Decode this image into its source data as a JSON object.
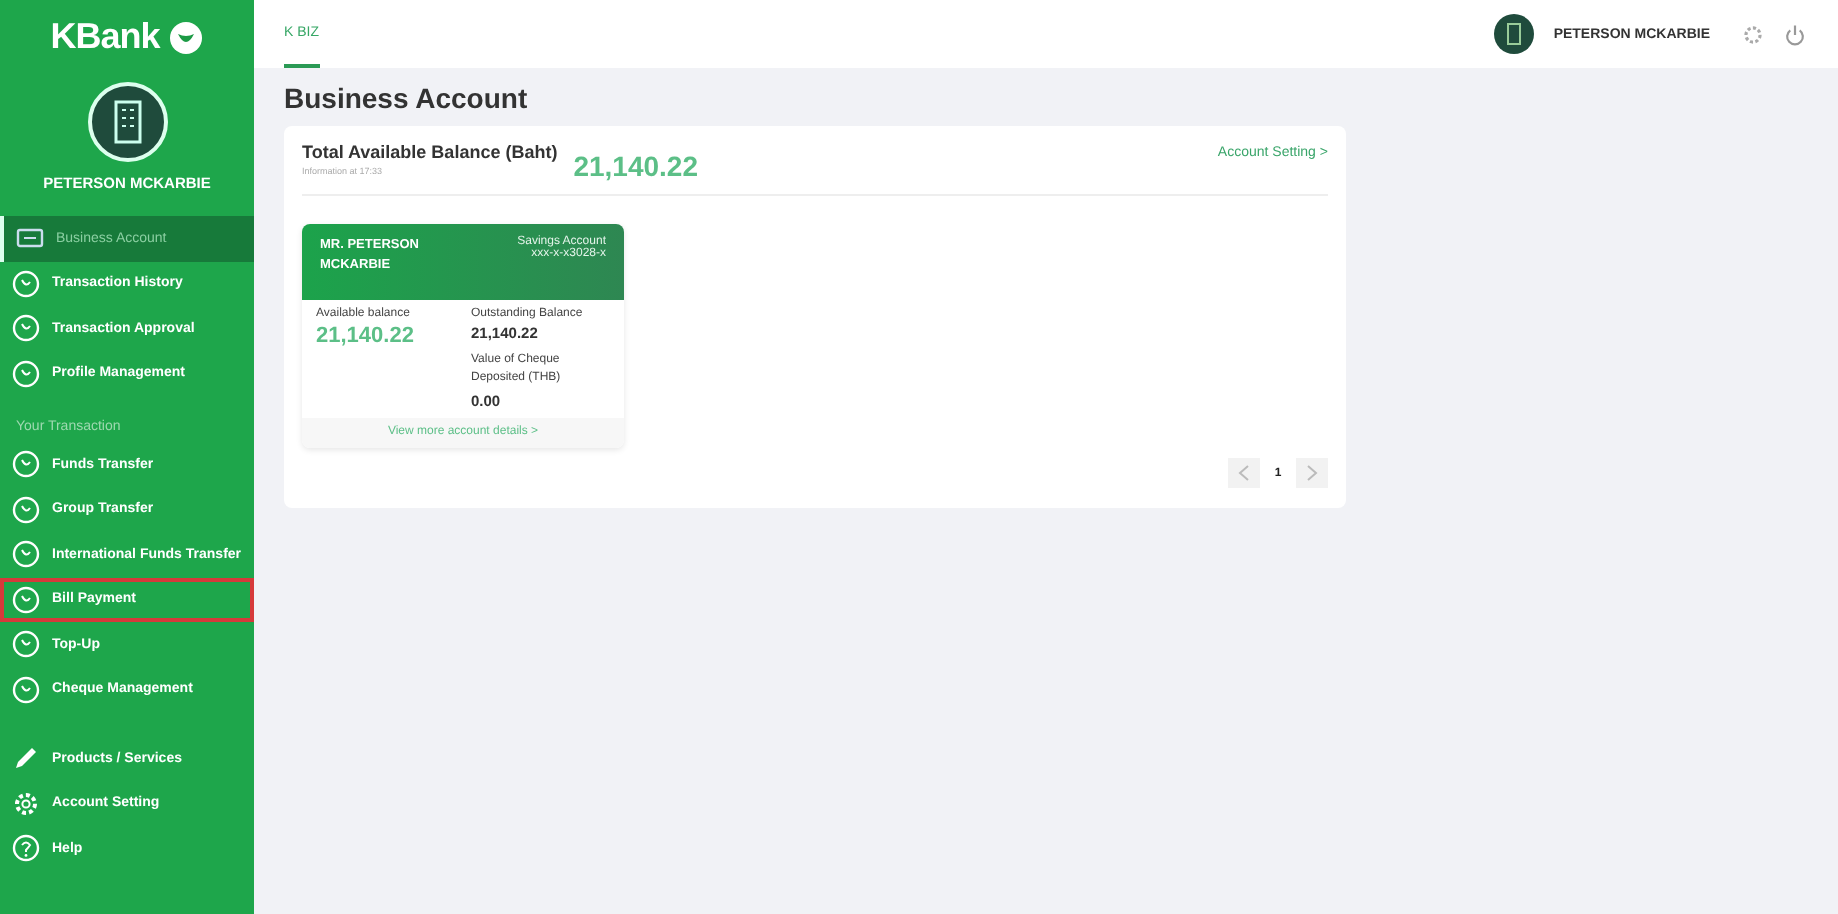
{
  "sidebar": {
    "logo": "KBank",
    "user_name": "PETERSON MCKARBIE",
    "groups": [
      {
        "items": [
          {
            "label": "Business Account",
            "kind": "card",
            "selected": true,
            "highlighted": false
          },
          {
            "label": "Transaction History",
            "kind": "circle",
            "selected": false,
            "highlighted": false
          },
          {
            "label": "Transaction Approval",
            "kind": "circle",
            "selected": false,
            "highlighted": false
          },
          {
            "label": "Profile Management",
            "kind": "circle",
            "selected": false,
            "highlighted": false
          }
        ]
      },
      {
        "heading": "Your Transaction",
        "items": [
          {
            "label": "Funds Transfer",
            "kind": "circle",
            "selected": false,
            "highlighted": false
          },
          {
            "label": "Group Transfer",
            "kind": "circle",
            "selected": false,
            "highlighted": false
          },
          {
            "label": "International Funds Transfer",
            "kind": "circle",
            "selected": false,
            "highlighted": false
          },
          {
            "label": "Bill Payment",
            "kind": "circle",
            "selected": false,
            "highlighted": true
          },
          {
            "label": "Top-Up",
            "kind": "circle",
            "selected": false,
            "highlighted": false
          },
          {
            "label": "Cheque Management",
            "kind": "circle",
            "selected": false,
            "highlighted": false
          }
        ]
      },
      {
        "items": [
          {
            "label": "Products / Services",
            "kind": "pencil",
            "selected": false,
            "highlighted": false
          },
          {
            "label": "Account Setting",
            "kind": "gear",
            "selected": false,
            "highlighted": false
          },
          {
            "label": "Help",
            "kind": "help",
            "selected": false,
            "highlighted": false
          }
        ]
      }
    ]
  },
  "topbar": {
    "tab": "K BIZ",
    "user_name": "PETERSON MCKARBIE"
  },
  "page_title": "Business Account",
  "balance": {
    "label": "Total Available Balance (Baht)",
    "updated": "Information at 17:33",
    "amount": "21,140.22",
    "link": "Account Setting >"
  },
  "account_card": {
    "holder": "MR. PETERSON MCKARBIE",
    "type": "Savings Account",
    "number": "xxx-x-x3028-x",
    "available_label": "Available balance",
    "available": "21,140.22",
    "outstanding_label": "Outstanding Balance",
    "outstanding": "21,140.22",
    "cheque_label": "Value of Cheque Deposited (THB)",
    "cheque": "0.00",
    "details_link": "View more account details >"
  },
  "pagination": {
    "pages": [
      {
        "label": "1",
        "selected": true
      }
    ]
  }
}
